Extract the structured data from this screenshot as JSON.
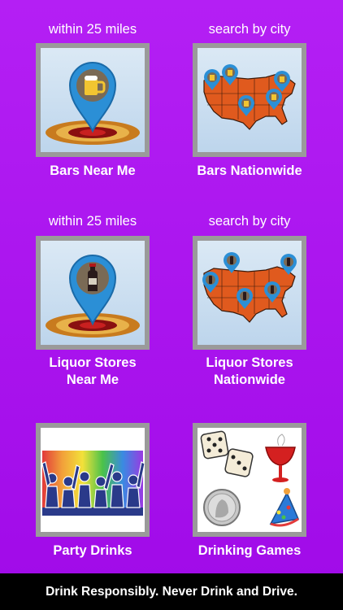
{
  "tiles": [
    {
      "caption": "within 25 miles",
      "label": "Bars Near Me",
      "icon": "beer-location-pin-icon"
    },
    {
      "caption": "search by city",
      "label": "Bars Nationwide",
      "icon": "us-map-beer-pins-icon"
    },
    {
      "caption": "within 25 miles",
      "label": "Liquor Stores Near Me",
      "label_line1": "Liquor Stores",
      "label_line2": "Near Me",
      "icon": "wine-location-pin-icon"
    },
    {
      "caption": "search by city",
      "label": "Liquor Stores Nationwide",
      "label_line1": "Liquor Stores",
      "label_line2": "Nationwide",
      "icon": "us-map-wine-pins-icon"
    },
    {
      "caption": "",
      "label": "Party Drinks",
      "icon": "party-crowd-icon"
    },
    {
      "caption": "",
      "label": "Drinking Games",
      "icon": "dice-coin-glass-icon"
    }
  ],
  "footer": {
    "text": "Drink Responsibly. Never Drink and Drive."
  },
  "colors": {
    "background": "#a812ee",
    "tile_border": "#9a9a9a",
    "pin_blue": "#2b8fd6",
    "footer": "#000000"
  }
}
